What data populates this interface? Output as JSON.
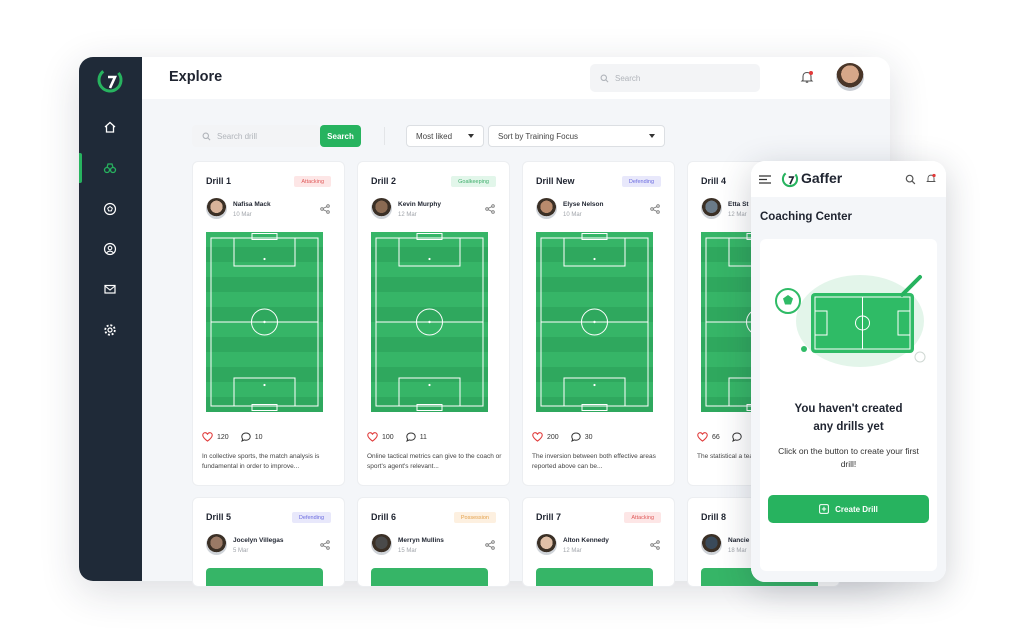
{
  "colors": {
    "accent": "#27b35f",
    "sidebar": "#1f2a38"
  },
  "header": {
    "title": "Explore",
    "search_placeholder": "Search"
  },
  "sidebar": {
    "items": [
      {
        "icon": "home-icon"
      },
      {
        "icon": "binoculars-icon",
        "active": true
      },
      {
        "icon": "soccer-ball-icon"
      },
      {
        "icon": "user-circle-icon"
      },
      {
        "icon": "mail-icon"
      },
      {
        "icon": "gear-icon"
      }
    ]
  },
  "filters": {
    "search_placeholder": "Search drill",
    "search_button": "Search",
    "sort_liked": "Most liked",
    "sort_focus": "Sort by Training Focus"
  },
  "cards": [
    {
      "title": "Drill 1",
      "badge": "Attacking",
      "author": "Nafisa Mack",
      "date": "10 Mar",
      "likes": "120",
      "comments": "10",
      "desc": "In collective sports, the match analysis is fundamental in order to improve..."
    },
    {
      "title": "Drill 2",
      "badge": "Goalkeeping",
      "author": "Kevin Murphy",
      "date": "12 Mar",
      "likes": "100",
      "comments": "11",
      "desc": "Online tactical metrics can give to the coach or sport's agent's relevant..."
    },
    {
      "title": "Drill New",
      "badge": "Defending",
      "author": "Elyse Nelson",
      "date": "10 Mar",
      "likes": "200",
      "comments": "30",
      "desc": "The inversion between both effective areas reported above can be..."
    },
    {
      "title": "Drill 4",
      "badge": "",
      "author": "Etta St",
      "date": "12 Mar",
      "likes": "66",
      "comments": "",
      "desc": "The statistical a team's centroid"
    },
    {
      "title": "Drill 5",
      "badge": "Defending",
      "author": "Jocelyn Villegas",
      "date": "5 Mar"
    },
    {
      "title": "Drill 6",
      "badge": "Possession",
      "author": "Merryn Mullins",
      "date": "15 Mar"
    },
    {
      "title": "Drill 7",
      "badge": "Attacking",
      "author": "Alton Kennedy",
      "date": "12 Mar"
    },
    {
      "title": "Drill 8",
      "badge": "",
      "author": "Nancie",
      "date": "18 Mar"
    }
  ],
  "phone": {
    "brand": "Gaffer",
    "title": "Coaching Center",
    "empty_line1": "You haven't created",
    "empty_line2": "any drills yet",
    "empty_sub": "Click on the button to create your first drill!",
    "create_button": "Create Drill"
  }
}
